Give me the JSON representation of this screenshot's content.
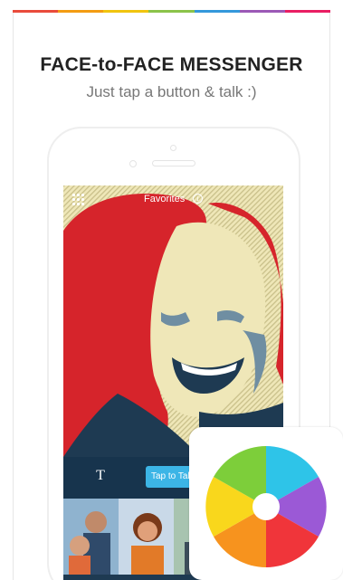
{
  "header": {
    "title": "FACE-to-FACE MESSENGER",
    "subtitle": "Just tap a button & talk :)"
  },
  "app_screen": {
    "top_bar": {
      "menu_icon": "grid-icon",
      "label": "Favorites",
      "info_icon": "info-icon"
    },
    "bottom_bar": {
      "text_button_label": "T",
      "talk_button_label": "Tap to Talk"
    },
    "thumbnails_count_visible": 4
  },
  "app_icon": {
    "name": "beach-ball-icon"
  },
  "colors": {
    "stripe": [
      "#e94b3c",
      "#f39c12",
      "#f1c40f",
      "#8bc34a",
      "#3498db",
      "#9b59b6",
      "#e91e63"
    ],
    "talk_button": "#3cb5e6",
    "photo_red": "#d6242b",
    "photo_cream": "#efe7b8",
    "photo_navy": "#1e3a52",
    "photo_slate": "#6f8ea2"
  }
}
